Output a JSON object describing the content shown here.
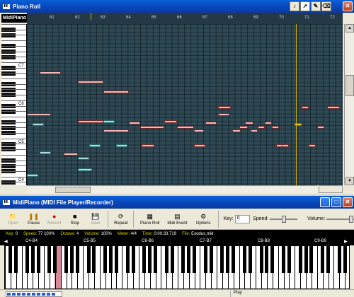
{
  "pianoroll": {
    "title": "Piano Roll",
    "ruler_label": "MidiPiano",
    "measures": [
      "61",
      "62",
      "63",
      "64",
      "65",
      "66",
      "67",
      "68",
      "69",
      "70",
      "71",
      "72"
    ],
    "key_labels": [
      "C7",
      "C6",
      "C5",
      "C4"
    ],
    "tools": [
      "speaker-icon",
      "arrow-icon",
      "pencil-icon",
      "eraser-icon"
    ]
  },
  "player": {
    "title": "MidiPiano (MIDI File Player/Recorder)",
    "toolbar": {
      "open": "Open",
      "pause": "Pause",
      "record": "Record",
      "stop": "Stop",
      "save": "Save",
      "repeat": "Repeat",
      "piano_roll": "Piano Roll",
      "midi_event": "Midi Event",
      "options": "Options",
      "key_label": "Key:",
      "key_value": "0",
      "speed_label": "Speed:",
      "volume_label": "Volume:"
    },
    "status": {
      "key_label": "Key:",
      "key_value": "0",
      "speed_label": "Speed:",
      "speed_value": "77",
      "speed_pct": "100%",
      "octave_label": "Octave:",
      "octave_value": "4",
      "volume_label": "Volume:",
      "volume_value": "100%",
      "meter_label": "Meter:",
      "meter_value": "4/4",
      "time_label": "Time:",
      "time_value": "0:00:33.719",
      "file_label": "File:",
      "file_value": "Exodus.mid"
    },
    "octaves": [
      "C4-B4",
      "C5-B5",
      "C6-B6",
      "C7-B7",
      "C8-B8",
      "C9-B9"
    ],
    "play_status": "Play",
    "progress": 0.9
  }
}
